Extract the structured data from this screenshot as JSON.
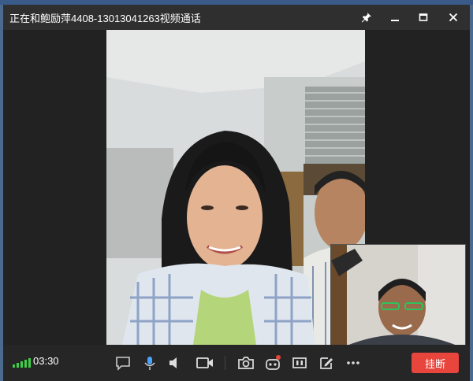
{
  "window": {
    "title": "正在和鲍励萍4408-13013041263视频通话"
  },
  "call": {
    "duration": "03:30"
  },
  "controls": {
    "hangup_label": "挂断"
  },
  "colors": {
    "hangup": "#e8453c",
    "signal": "#3ecf4a",
    "titlebar": "#2f2f2f"
  },
  "icons": [
    "pin-icon",
    "minimize-icon",
    "maximize-icon",
    "close-icon",
    "chat-icon",
    "microphone-icon",
    "speaker-icon",
    "camera-toggle-icon",
    "snapshot-icon",
    "robot-icon",
    "layout-icon",
    "whiteboard-icon",
    "more-icon",
    "signal-icon"
  ]
}
